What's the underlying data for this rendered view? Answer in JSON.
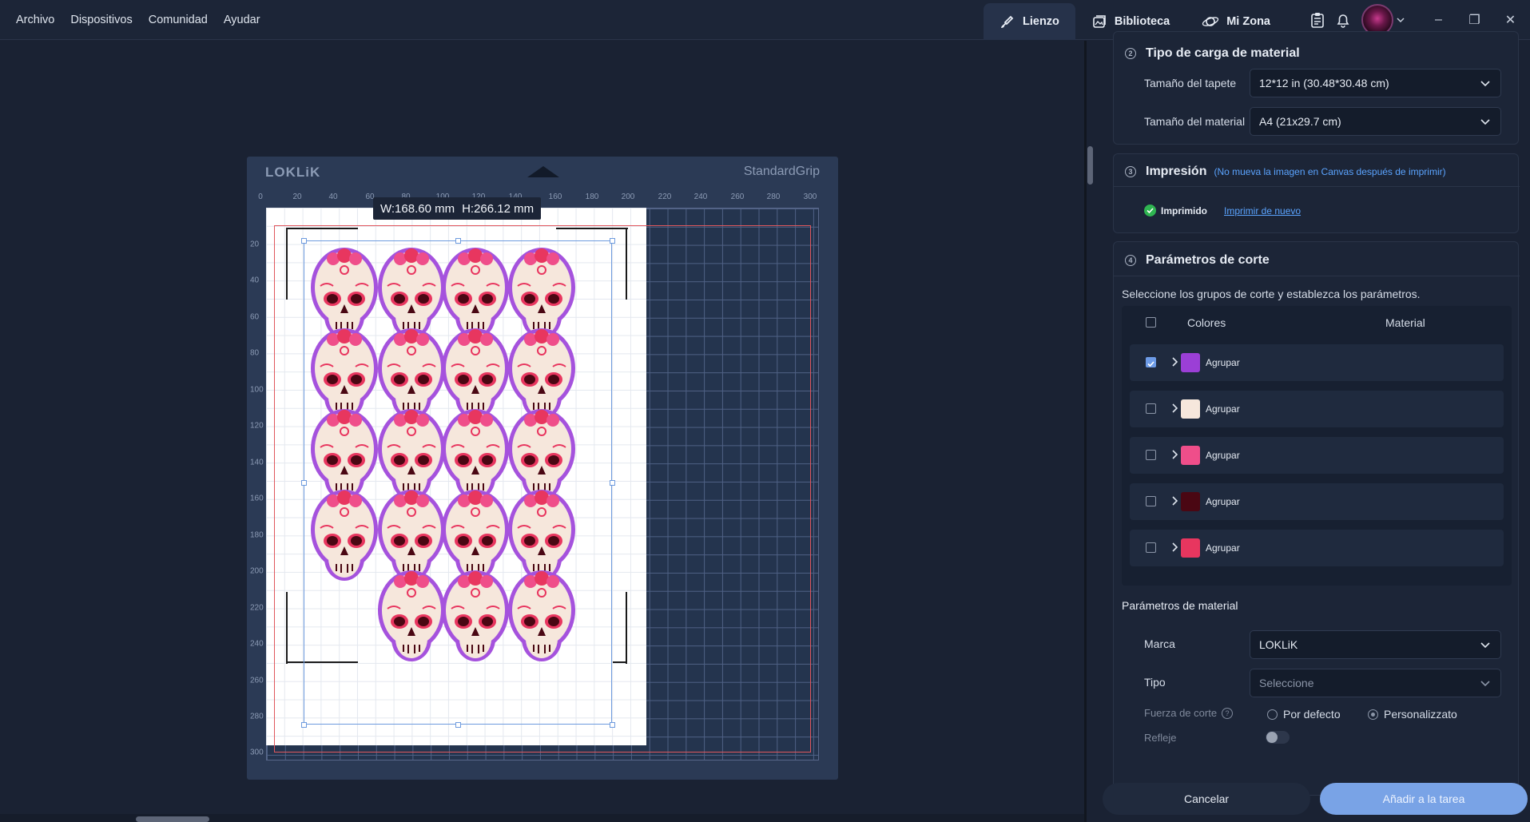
{
  "menu": [
    "Archivo",
    "Dispositivos",
    "Comunidad",
    "Ayudar"
  ],
  "nav": {
    "lienzo": "Lienzo",
    "biblioteca": "Biblioteca",
    "mizona": "Mi Zona"
  },
  "mat": {
    "brand": "LOKLiK",
    "name": "StandardGrip",
    "ruler_x": [
      "0",
      "20",
      "40",
      "60",
      "80",
      "100",
      "120",
      "140",
      "160",
      "180",
      "200",
      "220",
      "240",
      "260",
      "280",
      "300"
    ],
    "ruler_y": [
      "20",
      "40",
      "60",
      "80",
      "100",
      "120",
      "140",
      "160",
      "180",
      "200",
      "220",
      "240",
      "260",
      "280",
      "300"
    ],
    "dims": {
      "w": "W:168.60 mm",
      "h": "H:266.12 mm"
    }
  },
  "panel": {
    "load": {
      "title": "Tipo de carga de material",
      "mat_size_label": "Tamaño del tapete",
      "mat_size_value": "12*12 in (30.48*30.48 cm)",
      "material_size_label": "Tamaño del material",
      "material_size_value": "A4 (21x29.7 cm)"
    },
    "print": {
      "title": "Impresión",
      "note": "(No mueva la imagen en Canvas después de imprimir)",
      "status": "Imprimido",
      "reprint": "Imprimir de nuevo"
    },
    "cut": {
      "title": "Parámetros de corte",
      "desc": "Seleccione los grupos de corte y establezca los parámetros.",
      "col_colors": "Colores",
      "col_material": "Material",
      "groups": [
        {
          "label": "Agrupar",
          "color": "#9b3fd6",
          "checked": true
        },
        {
          "label": "Agrupar",
          "color": "#f6e7dc",
          "checked": false
        },
        {
          "label": "Agrupar",
          "color": "#ef4e8a",
          "checked": false
        },
        {
          "label": "Agrupar",
          "color": "#4a0713",
          "checked": false
        },
        {
          "label": "Agrupar",
          "color": "#e8365f",
          "checked": false
        }
      ],
      "material_params": "Parámetros de material",
      "brand_label": "Marca",
      "brand_value": "LOKLiK",
      "type_label": "Tipo",
      "type_placeholder": "Seleccione",
      "force_label": "Fuerza de corte",
      "force_default": "Por defecto",
      "force_custom": "Personalizzato",
      "mirror_label": "Refleje"
    },
    "cancel": "Cancelar",
    "add": "Añadir a la tarea"
  }
}
